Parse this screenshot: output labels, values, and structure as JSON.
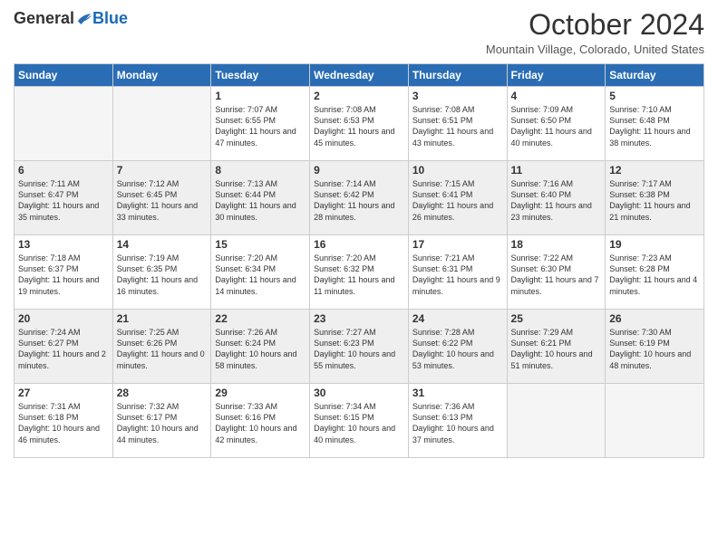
{
  "logo": {
    "general": "General",
    "blue": "Blue"
  },
  "title": "October 2024",
  "location": "Mountain Village, Colorado, United States",
  "days_of_week": [
    "Sunday",
    "Monday",
    "Tuesday",
    "Wednesday",
    "Thursday",
    "Friday",
    "Saturday"
  ],
  "weeks": [
    [
      {
        "day": "",
        "info": ""
      },
      {
        "day": "",
        "info": ""
      },
      {
        "day": "1",
        "info": "Sunrise: 7:07 AM\nSunset: 6:55 PM\nDaylight: 11 hours and 47 minutes."
      },
      {
        "day": "2",
        "info": "Sunrise: 7:08 AM\nSunset: 6:53 PM\nDaylight: 11 hours and 45 minutes."
      },
      {
        "day": "3",
        "info": "Sunrise: 7:08 AM\nSunset: 6:51 PM\nDaylight: 11 hours and 43 minutes."
      },
      {
        "day": "4",
        "info": "Sunrise: 7:09 AM\nSunset: 6:50 PM\nDaylight: 11 hours and 40 minutes."
      },
      {
        "day": "5",
        "info": "Sunrise: 7:10 AM\nSunset: 6:48 PM\nDaylight: 11 hours and 38 minutes."
      }
    ],
    [
      {
        "day": "6",
        "info": "Sunrise: 7:11 AM\nSunset: 6:47 PM\nDaylight: 11 hours and 35 minutes."
      },
      {
        "day": "7",
        "info": "Sunrise: 7:12 AM\nSunset: 6:45 PM\nDaylight: 11 hours and 33 minutes."
      },
      {
        "day": "8",
        "info": "Sunrise: 7:13 AM\nSunset: 6:44 PM\nDaylight: 11 hours and 30 minutes."
      },
      {
        "day": "9",
        "info": "Sunrise: 7:14 AM\nSunset: 6:42 PM\nDaylight: 11 hours and 28 minutes."
      },
      {
        "day": "10",
        "info": "Sunrise: 7:15 AM\nSunset: 6:41 PM\nDaylight: 11 hours and 26 minutes."
      },
      {
        "day": "11",
        "info": "Sunrise: 7:16 AM\nSunset: 6:40 PM\nDaylight: 11 hours and 23 minutes."
      },
      {
        "day": "12",
        "info": "Sunrise: 7:17 AM\nSunset: 6:38 PM\nDaylight: 11 hours and 21 minutes."
      }
    ],
    [
      {
        "day": "13",
        "info": "Sunrise: 7:18 AM\nSunset: 6:37 PM\nDaylight: 11 hours and 19 minutes."
      },
      {
        "day": "14",
        "info": "Sunrise: 7:19 AM\nSunset: 6:35 PM\nDaylight: 11 hours and 16 minutes."
      },
      {
        "day": "15",
        "info": "Sunrise: 7:20 AM\nSunset: 6:34 PM\nDaylight: 11 hours and 14 minutes."
      },
      {
        "day": "16",
        "info": "Sunrise: 7:20 AM\nSunset: 6:32 PM\nDaylight: 11 hours and 11 minutes."
      },
      {
        "day": "17",
        "info": "Sunrise: 7:21 AM\nSunset: 6:31 PM\nDaylight: 11 hours and 9 minutes."
      },
      {
        "day": "18",
        "info": "Sunrise: 7:22 AM\nSunset: 6:30 PM\nDaylight: 11 hours and 7 minutes."
      },
      {
        "day": "19",
        "info": "Sunrise: 7:23 AM\nSunset: 6:28 PM\nDaylight: 11 hours and 4 minutes."
      }
    ],
    [
      {
        "day": "20",
        "info": "Sunrise: 7:24 AM\nSunset: 6:27 PM\nDaylight: 11 hours and 2 minutes."
      },
      {
        "day": "21",
        "info": "Sunrise: 7:25 AM\nSunset: 6:26 PM\nDaylight: 11 hours and 0 minutes."
      },
      {
        "day": "22",
        "info": "Sunrise: 7:26 AM\nSunset: 6:24 PM\nDaylight: 10 hours and 58 minutes."
      },
      {
        "day": "23",
        "info": "Sunrise: 7:27 AM\nSunset: 6:23 PM\nDaylight: 10 hours and 55 minutes."
      },
      {
        "day": "24",
        "info": "Sunrise: 7:28 AM\nSunset: 6:22 PM\nDaylight: 10 hours and 53 minutes."
      },
      {
        "day": "25",
        "info": "Sunrise: 7:29 AM\nSunset: 6:21 PM\nDaylight: 10 hours and 51 minutes."
      },
      {
        "day": "26",
        "info": "Sunrise: 7:30 AM\nSunset: 6:19 PM\nDaylight: 10 hours and 48 minutes."
      }
    ],
    [
      {
        "day": "27",
        "info": "Sunrise: 7:31 AM\nSunset: 6:18 PM\nDaylight: 10 hours and 46 minutes."
      },
      {
        "day": "28",
        "info": "Sunrise: 7:32 AM\nSunset: 6:17 PM\nDaylight: 10 hours and 44 minutes."
      },
      {
        "day": "29",
        "info": "Sunrise: 7:33 AM\nSunset: 6:16 PM\nDaylight: 10 hours and 42 minutes."
      },
      {
        "day": "30",
        "info": "Sunrise: 7:34 AM\nSunset: 6:15 PM\nDaylight: 10 hours and 40 minutes."
      },
      {
        "day": "31",
        "info": "Sunrise: 7:36 AM\nSunset: 6:13 PM\nDaylight: 10 hours and 37 minutes."
      },
      {
        "day": "",
        "info": ""
      },
      {
        "day": "",
        "info": ""
      }
    ]
  ]
}
